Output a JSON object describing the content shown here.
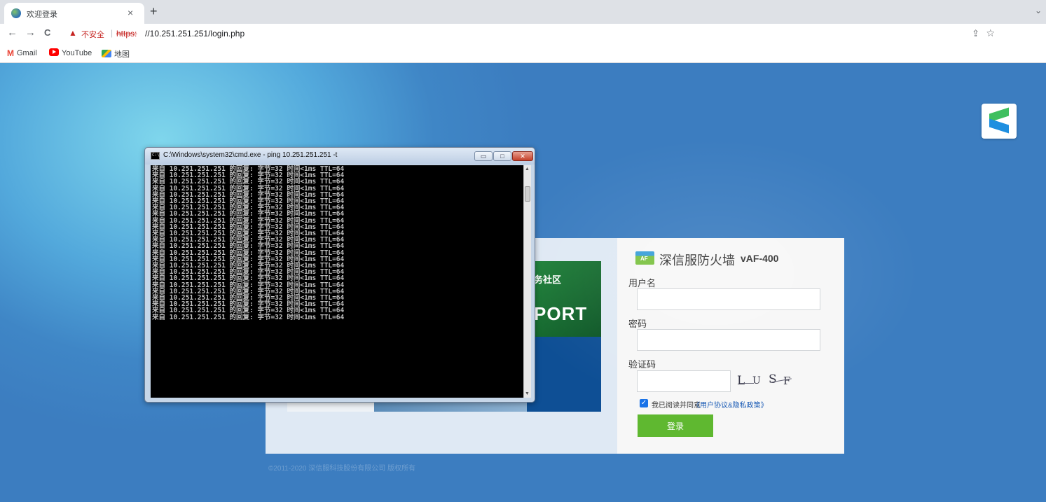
{
  "browser": {
    "tab_title": "欢迎登录",
    "tab_close": "×",
    "new_tab": "+",
    "tab_list": "⌄",
    "nav": {
      "back": "←",
      "forward": "→",
      "reload": "C"
    },
    "security_label": "不安全",
    "url_scheme": "https:",
    "url_rest": "//10.251.251.251/login.php",
    "bookmarks": [
      "Gmail",
      "YouTube",
      "地图"
    ]
  },
  "login": {
    "brand_name": "深信服防火墙",
    "model": "vAF-400",
    "username_label": "用户名",
    "username_value": "",
    "password_label": "密码",
    "password_value": "",
    "captcha_label": "验证码",
    "captcha_value": "",
    "captcha_chars": [
      "L",
      "U",
      "S",
      "F"
    ],
    "agree_text": "我已阅读并同意",
    "agree_link": "《用户协议&隐私政策》",
    "agree_checked": true,
    "login_button": "登录"
  },
  "banner": {
    "text_top": "务社区",
    "text_big": "PORT"
  },
  "copyright": "©2011-2020 深信服科技股份有限公司 版权所有",
  "cmd": {
    "title": "C:\\Windows\\system32\\cmd.exe - ping  10.251.251.251 -t",
    "minimize": "▭",
    "maximize": "□",
    "close": "✕",
    "line": "来自 10.251.251.251 的回复: 字节=32 时间<1ms TTL=64",
    "line_count": 24
  }
}
